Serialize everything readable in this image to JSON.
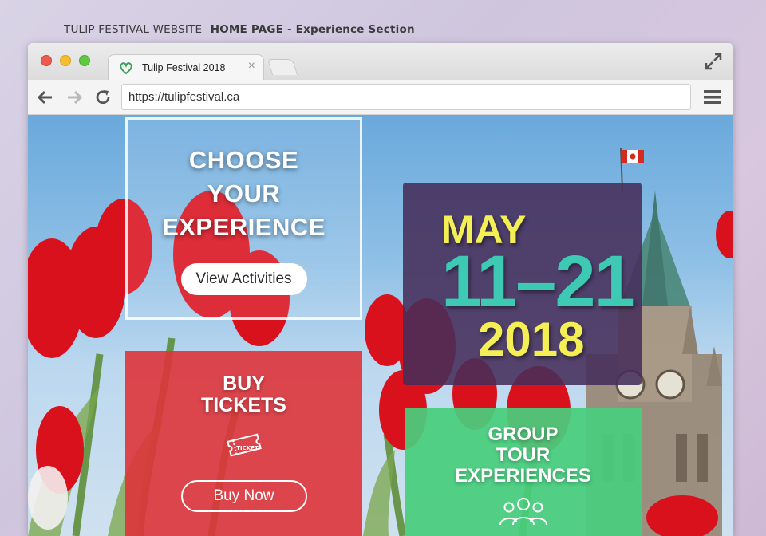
{
  "caption": {
    "prefix": "TULIP FESTIVAL WEBSITE",
    "title": "HOME PAGE - Experience Section"
  },
  "browser": {
    "tab_title": "Tulip Festival 2018",
    "tab_close": "×",
    "url": "https://tulipfestival.ca"
  },
  "hero": {
    "choose": {
      "line1": "CHOOSE",
      "line2": "YOUR",
      "line3": "EXPERIENCE",
      "button": "View Activities"
    },
    "dates": {
      "month": "MAY",
      "days": "11–21",
      "year": "2018"
    },
    "tickets": {
      "line1": "BUY",
      "line2": "TICKETS",
      "ticket_icon_text": "TICKET",
      "button": "Buy Now"
    },
    "group": {
      "line1": "GROUP",
      "line2": "TOUR",
      "line3": "EXPERIENCES"
    }
  },
  "colors": {
    "tickets_card": "#de343a",
    "group_card": "#48cd7d",
    "date_card": "#462d5a",
    "date_yellow": "#f4ef55",
    "date_teal": "#3ec9b4"
  },
  "icons": {
    "favicon": "tulip-heart-icon",
    "expand": "expand-arrows-icon",
    "back": "back-arrow-icon",
    "forward": "forward-arrow-icon",
    "reload": "reload-icon",
    "menu": "hamburger-menu-icon",
    "ticket": "ticket-icon",
    "group": "group-people-icon"
  }
}
